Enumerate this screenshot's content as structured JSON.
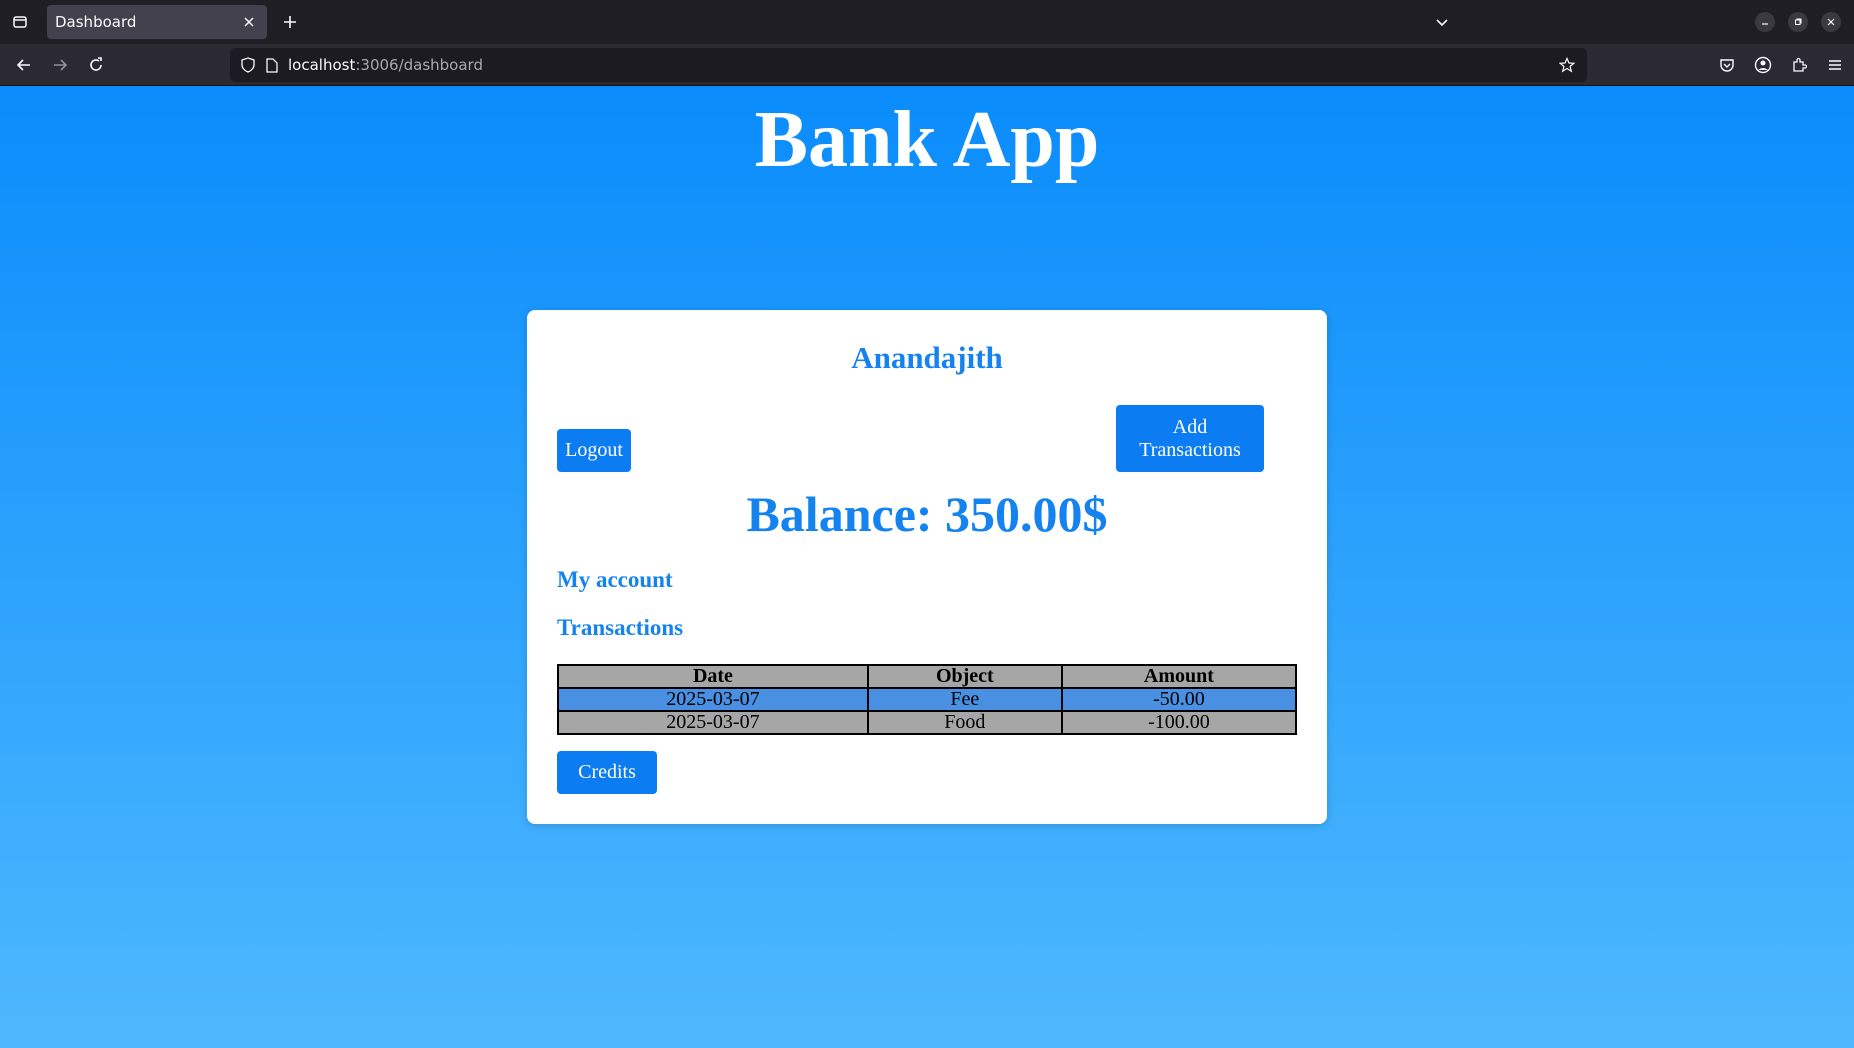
{
  "browser": {
    "tab_title": "Dashboard",
    "url_host": "localhost",
    "url_rest": ":3006/dashboard"
  },
  "app": {
    "title": "Bank App"
  },
  "dashboard": {
    "username": "Anandajith",
    "logout_label": "Logout",
    "add_transactions_label": "Add Transactions",
    "balance_text": "Balance: 350.00$",
    "my_account_heading": "My account",
    "transactions_heading": "Transactions",
    "credits_label": "Credits"
  },
  "transactions_table": {
    "headers": [
      "Date",
      "Object",
      "Amount"
    ],
    "rows": [
      {
        "date": "2025-03-07",
        "object": "Fee",
        "amount": "-50.00"
      },
      {
        "date": "2025-03-07",
        "object": "Food",
        "amount": "-100.00"
      }
    ]
  },
  "colors": {
    "accent": "#0b7cf2",
    "heading_blue": "#1483f0",
    "row_highlight": "#4a90e2",
    "row_gray": "#a6a6a6"
  },
  "icons": [
    "tab-list-icon",
    "close-icon",
    "plus-icon",
    "chevron-down-icon",
    "minimize-icon",
    "restore-icon",
    "back-icon",
    "forward-icon",
    "reload-icon",
    "shield-icon",
    "page-icon",
    "star-icon",
    "pocket-icon",
    "account-icon",
    "extensions-icon",
    "menu-icon"
  ]
}
